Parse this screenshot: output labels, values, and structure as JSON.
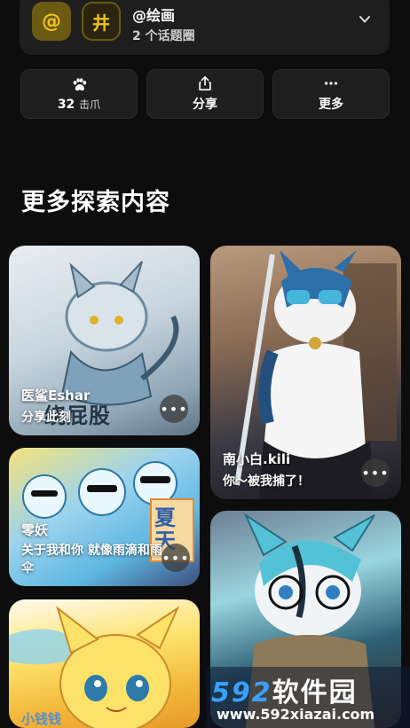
{
  "topic": {
    "badge_at": "@",
    "badge_hash": "井",
    "name": "@绘画",
    "sub": "2 个话题圈"
  },
  "actions": {
    "claw_count": "32",
    "claw_unit": "击爪",
    "share_label": "分享",
    "more_label": "更多"
  },
  "section_title": "更多探索内容",
  "cards": [
    {
      "title": "医鲨Eshar",
      "sub": "分享此刻",
      "art_text": "绕屁股"
    },
    {
      "title": "南小白.kili",
      "sub": "你～被我捕了！"
    },
    {
      "title": "零妖",
      "sub": "关于我和你 就像雨滴和雨伞",
      "art_text": "夏天"
    },
    {
      "title": ""
    },
    {
      "title": "小钱钱"
    }
  ],
  "watermark": {
    "main": "592",
    "main_suffix": "软件园",
    "url": "www.592xiazai.com"
  },
  "more_glyph": "•••"
}
